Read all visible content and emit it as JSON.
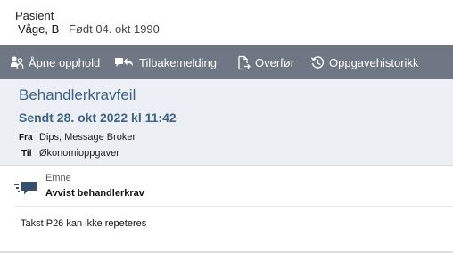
{
  "patient": {
    "label": "Pasient",
    "name": "Våge, B",
    "born": "Født 04. okt 1990"
  },
  "toolbar": {
    "open_case_label": "Åpne opphold",
    "feedback_label": "Tilbakemelding",
    "transfer_label": "Overfør",
    "task_history_label": "Oppgavehistorikk",
    "icons": [
      "people-icon",
      "reply-icon",
      "transfer-document-icon",
      "history-icon"
    ]
  },
  "message": {
    "type": "Behandlerkravfeil",
    "sent": "Sendt 28. okt 2022 kl 11:42",
    "from_key": "Fra",
    "from_value": "Dips, Message Broker",
    "to_key": "Til",
    "to_value": "Økonomioppgaver"
  },
  "subject": {
    "label": "Emne",
    "value": "Avvist behandlerkrav",
    "icon": "message-list-icon"
  },
  "body": {
    "text": "Takst P26 kan ikke repeteres"
  },
  "colors": {
    "toolbar_bg": "#6f7784",
    "header_bg": "#eceff3",
    "accent_text": "#3e6387"
  }
}
